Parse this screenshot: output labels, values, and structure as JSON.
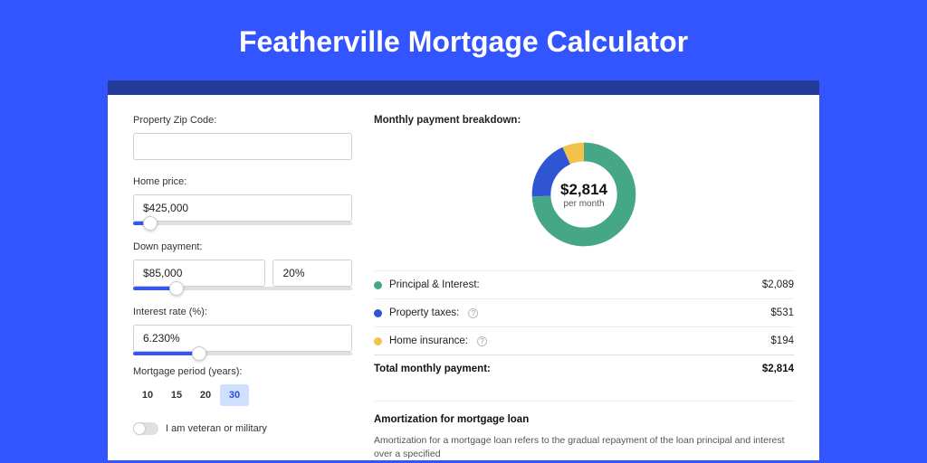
{
  "title": "Featherville Mortgage Calculator",
  "colors": {
    "accent": "#3355ff",
    "green": "#46a786",
    "blue": "#2f55d4",
    "yellow": "#f3c24b"
  },
  "form": {
    "zip": {
      "label": "Property Zip Code:",
      "value": ""
    },
    "price": {
      "label": "Home price:",
      "value": "$425,000",
      "slider_pct": 8
    },
    "down": {
      "label": "Down payment:",
      "amount": "$85,000",
      "pct": "20%",
      "slider_pct": 20
    },
    "rate": {
      "label": "Interest rate (%):",
      "value": "6.230%",
      "slider_pct": 30
    },
    "period": {
      "label": "Mortgage period (years):",
      "options": [
        "10",
        "15",
        "20",
        "30"
      ],
      "selected": "30"
    },
    "veteran": {
      "label": "I am veteran or military",
      "on": false
    }
  },
  "breakdown": {
    "title": "Monthly payment breakdown:",
    "total_value": "$2,814",
    "total_sub": "per month",
    "rows": {
      "pi": {
        "label": "Principal & Interest:",
        "value": "$2,089"
      },
      "tax": {
        "label": "Property taxes:",
        "value": "$531"
      },
      "ins": {
        "label": "Home insurance:",
        "value": "$194"
      }
    },
    "total_row": {
      "label": "Total monthly payment:",
      "value": "$2,814"
    }
  },
  "chart_data": {
    "type": "pie",
    "title": "Monthly payment breakdown",
    "series": [
      {
        "name": "Principal & Interest",
        "value": 2089,
        "color": "#46a786"
      },
      {
        "name": "Property taxes",
        "value": 531,
        "color": "#2f55d4"
      },
      {
        "name": "Home insurance",
        "value": 194,
        "color": "#f3c24b"
      }
    ],
    "total": 2814,
    "center_label": "$2,814",
    "center_sub": "per month"
  },
  "amortization": {
    "title": "Amortization for mortgage loan",
    "text": "Amortization for a mortgage loan refers to the gradual repayment of the loan principal and interest over a specified"
  }
}
